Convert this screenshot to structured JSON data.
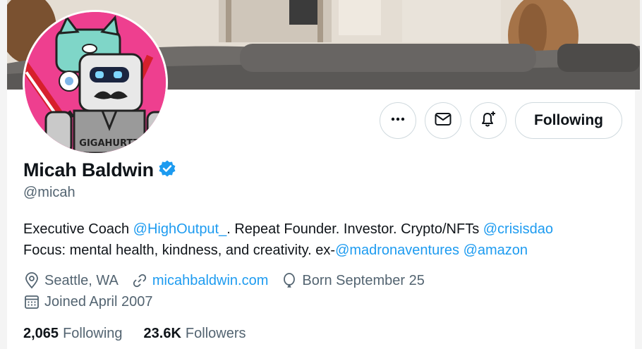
{
  "profile": {
    "display_name": "Micah Baldwin",
    "handle": "@micah",
    "verified": true,
    "avatar_text": "GIGAHURTZ"
  },
  "actions": {
    "more_icon": "more-horizontal-icon",
    "message_icon": "envelope-icon",
    "notify_icon": "bell-plus-icon",
    "following_label": "Following"
  },
  "bio": {
    "line1": {
      "t1": "Executive Coach ",
      "m1": "@HighOutput_",
      "t2": ". Repeat Founder. Investor. Crypto/NFTs  ",
      "m2": "@crisisdao"
    },
    "line2": {
      "t1": "Focus: mental health, kindness, and creativity. ex-",
      "m1": "@madronaventures",
      "t2": " ",
      "m2": "@amazon"
    }
  },
  "meta": {
    "location": "Seattle, WA",
    "website": "micahbaldwin.com",
    "birthday": "Born September 25",
    "joined": "Joined April 2007"
  },
  "stats": {
    "following_count": "2,065",
    "following_label": "Following",
    "followers_count": "23.6K",
    "followers_label": "Followers"
  },
  "colors": {
    "accent": "#1d9bf0",
    "text": "#0f1419",
    "secondary": "#536471",
    "border": "#cfd9de",
    "avatar_bg": "#ee3f8f"
  }
}
